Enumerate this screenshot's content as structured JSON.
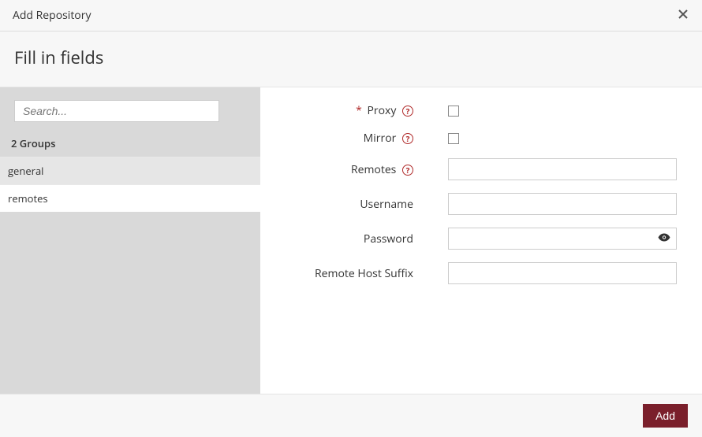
{
  "header": {
    "title": "Add Repository"
  },
  "subheader": {
    "title": "Fill in fields"
  },
  "sidebar": {
    "search_placeholder": "Search...",
    "groups_count": "2 Groups",
    "items": [
      {
        "label": "general",
        "active": false
      },
      {
        "label": "remotes",
        "active": true
      }
    ]
  },
  "form": {
    "proxy_label": "Proxy",
    "mirror_label": "Mirror",
    "remotes_label": "Remotes",
    "username_label": "Username",
    "password_label": "Password",
    "remote_host_suffix_label": "Remote Host Suffix",
    "help_glyph": "?"
  },
  "footer": {
    "add_label": "Add"
  }
}
